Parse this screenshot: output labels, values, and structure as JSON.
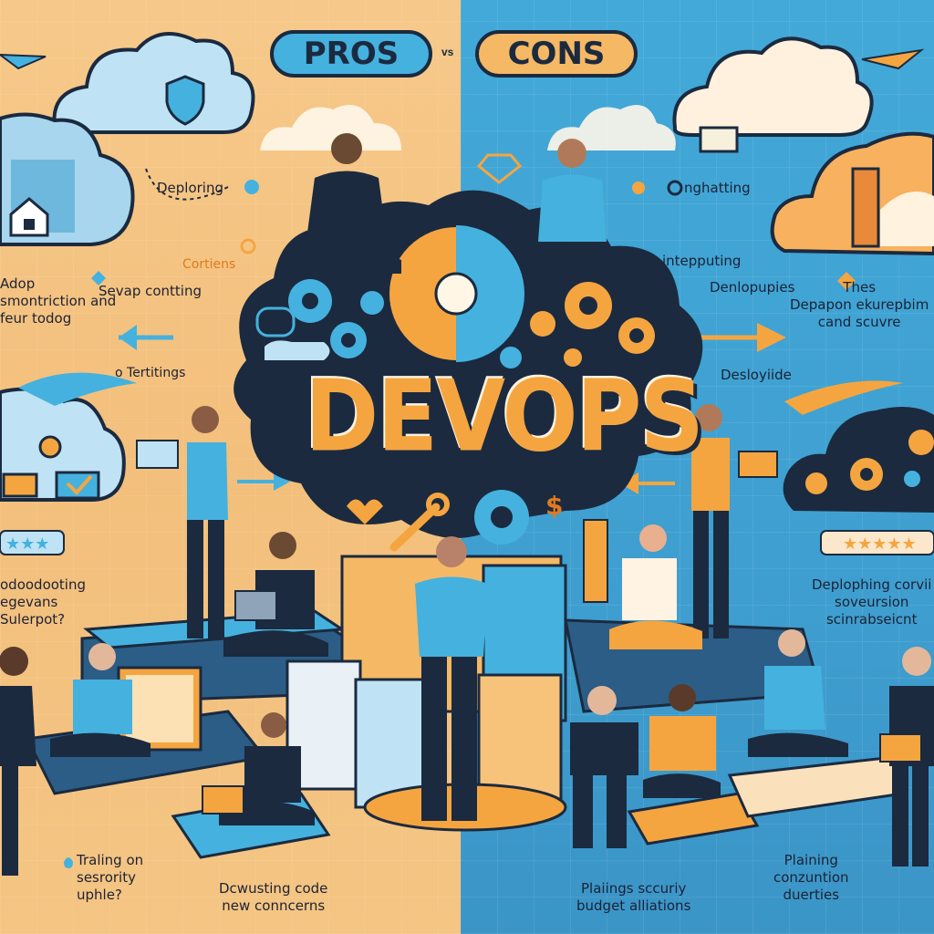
{
  "header": {
    "pros_label": "PROS",
    "vs_label": "vs",
    "cons_label": "CONS"
  },
  "left": {
    "deploring": "Deploring",
    "cortiens": "Cortiens",
    "adop": "Adop\nsmontriction and\nfeur todog",
    "sevap": "Sevap contting",
    "tertitings": "o Tertitings",
    "dodoodoting": "odoodooting\negevans\nSulerpot?",
    "trailing": "Traling on\nsesrority\nuphle?",
    "deusting": "Dcwusting code\nnew conncerns"
  },
  "right": {
    "nghatting": "nghatting",
    "intepputing": "intepputing",
    "denloppies": "Denlopupies",
    "thes": "Thes\nDepapon ekurepbim\ncand scuvre",
    "desloyide": "Desloyiide",
    "deplophing": "Deplophing corvii\nsoveursion\nscinrabseicnt",
    "plaining_security": "Plaiings sccuriy\nbudget alliations",
    "plaining_conz": "Plaining\nconzuntion\nduerties"
  },
  "center": {
    "title": "DEVOPS",
    "dollar": "$"
  },
  "colors": {
    "left_bg": "#f5c584",
    "right_bg": "#42a9d8",
    "navy": "#1b2a3f",
    "orange": "#f5a540",
    "blue": "#45b1de"
  }
}
